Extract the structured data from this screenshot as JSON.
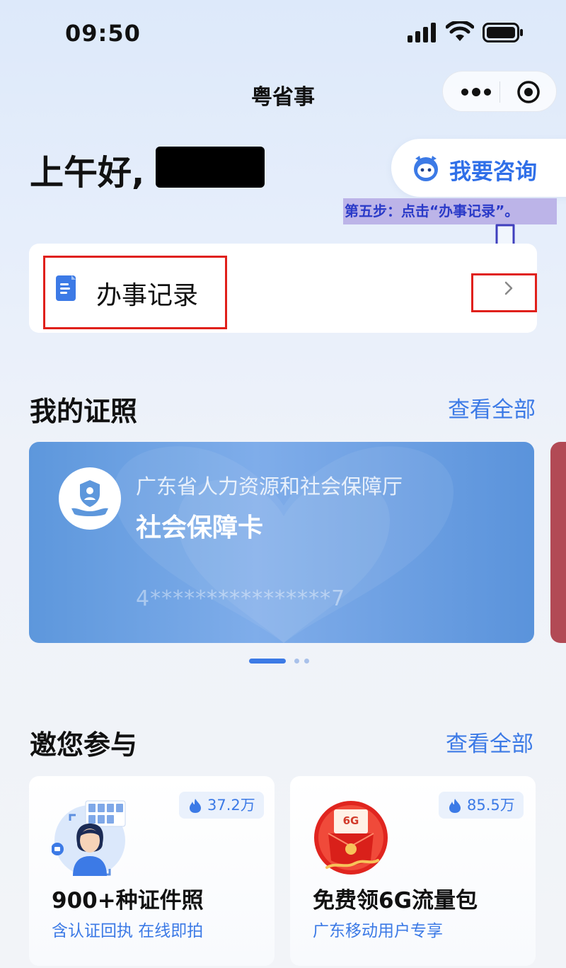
{
  "status": {
    "time": "09:50"
  },
  "nav": {
    "title": "粤省事"
  },
  "greeting": {
    "text": "上午好,"
  },
  "consult": {
    "label": "我要咨询"
  },
  "annotation": {
    "text": "第五步：点击“办事记录”。"
  },
  "record": {
    "label": "办事记录"
  },
  "certificates": {
    "title": "我的证照",
    "view_all": "查看全部",
    "card": {
      "org": "广东省人力资源和社会保障厅",
      "name": "社会保障卡",
      "number": "4****************7"
    }
  },
  "invite": {
    "title": "邀您参与",
    "view_all": "查看全部",
    "items": [
      {
        "title": "900+种证件照",
        "subtitle": "含认证回执 在线即拍",
        "hot": "37.2万",
        "icon": "id-photo-icon"
      },
      {
        "title": "免费领6G流量包",
        "subtitle": "广东移动用户专享",
        "hot": "85.5万",
        "icon": "data-package-icon",
        "badge": "6G"
      }
    ]
  },
  "colors": {
    "accent": "#3c7ae6",
    "highlight": "#e0201b",
    "annotation_bg": "#bcb4e8",
    "card": "#6a9fe2"
  }
}
